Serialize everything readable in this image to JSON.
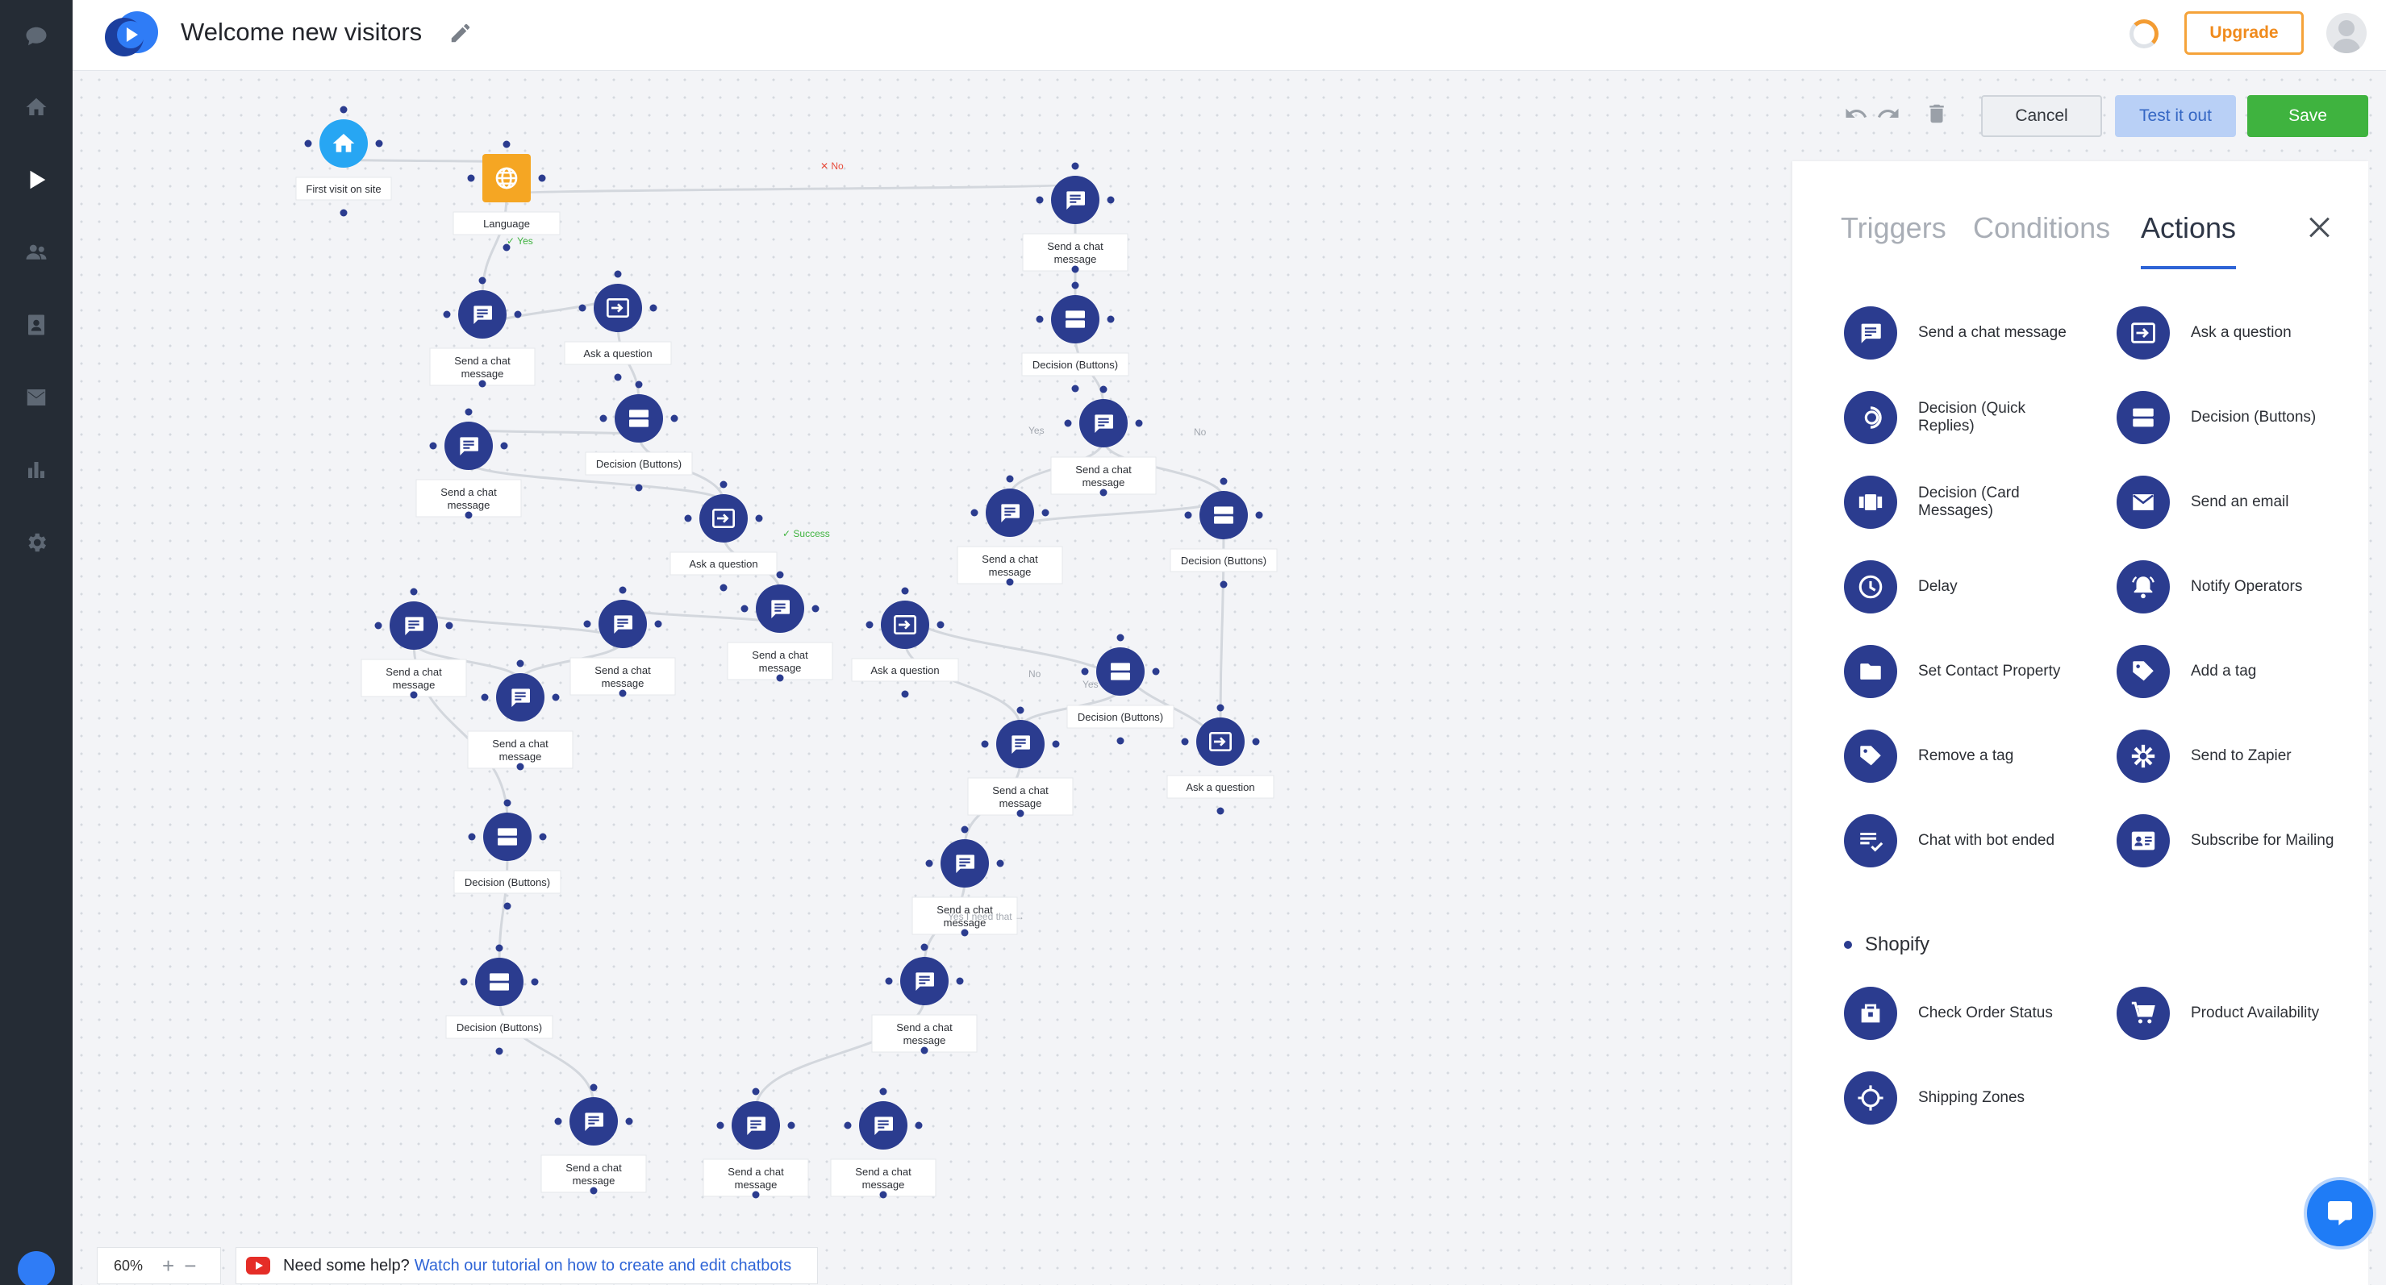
{
  "app": {
    "title": "Welcome new visitors",
    "accent": "#2e64d6",
    "node_color": "#2b3c8f"
  },
  "rail": {
    "items": [
      {
        "name": "chat-icon"
      },
      {
        "name": "home-icon"
      },
      {
        "name": "play-icon",
        "active": true
      },
      {
        "name": "users-icon"
      },
      {
        "name": "contacts-icon"
      },
      {
        "name": "mail-icon"
      },
      {
        "name": "stats-icon"
      },
      {
        "name": "settings-icon"
      }
    ]
  },
  "header": {
    "upgrade_label": "Upgrade"
  },
  "toolbar": {
    "cancel_label": "Cancel",
    "test_label": "Test it out",
    "save_label": "Save"
  },
  "panel": {
    "tabs": [
      "Triggers",
      "Conditions",
      "Actions"
    ],
    "active_tab": "Actions",
    "actions": [
      {
        "label": "Send a chat message",
        "icon": "chat-icon"
      },
      {
        "label": "Ask a question",
        "icon": "question-icon"
      },
      {
        "label": "Decision (Quick Replies)",
        "icon": "quick-replies-icon"
      },
      {
        "label": "Decision (Buttons)",
        "icon": "buttons-icon"
      },
      {
        "label": "Decision (Card Messages)",
        "icon": "cards-icon"
      },
      {
        "label": "Send an email",
        "icon": "email-icon"
      },
      {
        "label": "Delay",
        "icon": "clock-icon"
      },
      {
        "label": "Notify Operators",
        "icon": "bell-icon"
      },
      {
        "label": "Set Contact Property",
        "icon": "folder-icon"
      },
      {
        "label": "Add a tag",
        "icon": "tag-icon"
      },
      {
        "label": "Remove a tag",
        "icon": "tag-icon"
      },
      {
        "label": "Send to Zapier",
        "icon": "zapier-icon"
      },
      {
        "label": "Chat with bot ended",
        "icon": "checklist-icon"
      },
      {
        "label": "Subscribe for Mailing",
        "icon": "id-card-icon"
      }
    ],
    "shopify_header": "Shopify",
    "shopify_actions": [
      {
        "label": "Check Order Status",
        "icon": "order-icon"
      },
      {
        "label": "Product Availability",
        "icon": "cart-icon"
      },
      {
        "label": "Shipping Zones",
        "icon": "target-icon"
      }
    ]
  },
  "flow": {
    "nodes": [
      {
        "id": "n1",
        "type": "home",
        "label": "First visit on site"
      },
      {
        "id": "n2",
        "type": "language",
        "label": "Language"
      },
      {
        "id": "n3",
        "type": "chat",
        "label": "Send a chat message"
      },
      {
        "id": "n4",
        "type": "question",
        "label": "Ask a question"
      },
      {
        "id": "n5",
        "type": "buttons",
        "label": "Decision (Buttons)"
      },
      {
        "id": "n6",
        "type": "chat",
        "label": "Send a chat message"
      },
      {
        "id": "n7",
        "type": "question",
        "label": "Ask a question"
      },
      {
        "id": "n8",
        "type": "chat",
        "label": "Send a chat message"
      },
      {
        "id": "n9",
        "type": "buttons",
        "label": "Decision (Buttons)"
      },
      {
        "id": "n10",
        "type": "chat",
        "label": "Send a chat message"
      },
      {
        "id": "n11",
        "type": "chat",
        "label": "Send a chat message"
      },
      {
        "id": "n12",
        "type": "buttons",
        "label": "Decision (Buttons)"
      },
      {
        "id": "n13",
        "type": "chat",
        "label": "Send a chat message"
      },
      {
        "id": "n14",
        "type": "chat",
        "label": "Send a chat message"
      },
      {
        "id": "n15",
        "type": "chat",
        "label": "Send a chat message"
      },
      {
        "id": "n16",
        "type": "question",
        "label": "Ask a question"
      },
      {
        "id": "n17",
        "type": "buttons",
        "label": "Decision (Buttons)"
      },
      {
        "id": "n18",
        "type": "chat",
        "label": "Send a chat message"
      },
      {
        "id": "n19",
        "type": "question",
        "label": "Ask a question"
      },
      {
        "id": "n20",
        "type": "chat",
        "label": "Send a chat message"
      },
      {
        "id": "n21",
        "type": "buttons",
        "label": "Decision (Buttons)"
      },
      {
        "id": "n22",
        "type": "chat",
        "label": "Send a chat message"
      },
      {
        "id": "n23",
        "type": "chat",
        "label": "Send a chat message"
      },
      {
        "id": "n24",
        "type": "buttons",
        "label": "Decision (Buttons)"
      },
      {
        "id": "n25",
        "type": "chat",
        "label": "Send a chat message"
      }
    ],
    "edge_labels": [
      {
        "id": "e1",
        "text": "Yes",
        "status": "yes"
      },
      {
        "id": "e2",
        "text": "No",
        "status": "no"
      },
      {
        "id": "e3",
        "text": "Success",
        "status": "yes"
      },
      {
        "id": "e4",
        "text": "Yes",
        "status": "plain"
      },
      {
        "id": "e5",
        "text": "No",
        "status": "plain"
      },
      {
        "id": "e6",
        "text": "No",
        "status": "plain"
      },
      {
        "id": "e7",
        "text": "Yes",
        "status": "plain"
      },
      {
        "id": "e8",
        "text": "Yes I need that →",
        "status": "plain"
      }
    ]
  },
  "footer": {
    "zoom": "60%",
    "help_prefix": "Need some help?",
    "help_link": "Watch our tutorial on how to create and edit chatbots"
  }
}
